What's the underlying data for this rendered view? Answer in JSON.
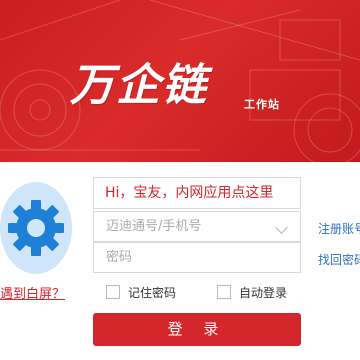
{
  "banner": {
    "brand_title": "万企链",
    "brand_subtitle": "工作站",
    "accent": "#d3272b"
  },
  "login_form": {
    "greeting": "Hi，宝友，内网应用点这里",
    "username_placeholder": "迈迪通号/手机号",
    "password_placeholder": "密码",
    "remember_label": "记住密码",
    "autologin_label": "自动登录",
    "login_label": "登 录",
    "register_link": "注册账号",
    "recover_link": "找回密码",
    "white_screen_link": "遇到白屏？"
  },
  "avatar": {
    "icon": "gear-icon",
    "color": "#1e7fd6",
    "background": "#cfe6fa"
  }
}
